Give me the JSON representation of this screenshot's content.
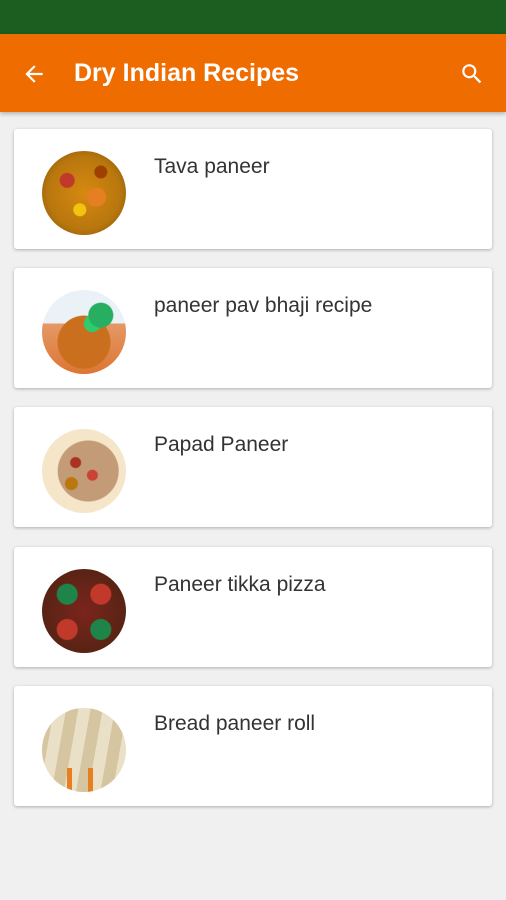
{
  "colors": {
    "status_bar": "#1b5e20",
    "app_bar": "#ef6c00",
    "background": "#f0f0f0",
    "card": "#ffffff",
    "title_text": "#333333"
  },
  "app_bar": {
    "title": "Dry Indian Recipes",
    "back_icon": "arrow-back-icon",
    "search_icon": "search-icon"
  },
  "recipes": [
    {
      "title": "Tava paneer",
      "image": "tava-paneer-thumbnail"
    },
    {
      "title": "paneer pav bhaji recipe",
      "image": "paneer-pav-bhaji-thumbnail"
    },
    {
      "title": "Papad Paneer",
      "image": "papad-paneer-thumbnail"
    },
    {
      "title": "Paneer tikka pizza",
      "image": "paneer-tikka-pizza-thumbnail"
    },
    {
      "title": "Bread paneer roll",
      "image": "bread-paneer-roll-thumbnail"
    }
  ]
}
